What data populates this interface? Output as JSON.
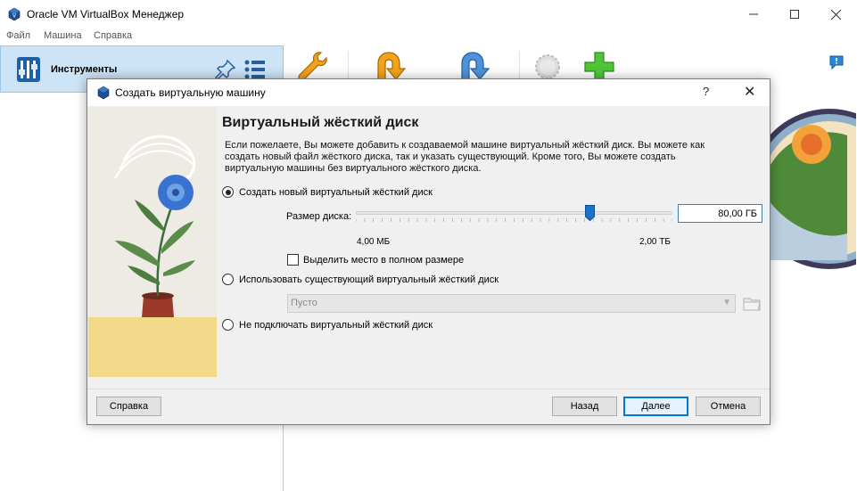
{
  "window": {
    "title": "Oracle VM VirtualBox Менеджер"
  },
  "menu": [
    "Файл",
    "Машина",
    "Справка"
  ],
  "toolbar": {
    "tools_label": "Инструменты"
  },
  "dialog": {
    "title": "Создать виртуальную машину",
    "help_glyph": "?",
    "close_glyph": "✕",
    "heading": "Виртуальный жёсткий диск",
    "description": "Если пожелаете, Вы можете добавить к создаваемой машине виртуальный жёсткий диск. Вы можете как создать новый файл жёсткого диска, так и указать существующий. Кроме того, Вы можете создать виртуальную машины без виртуального жёсткого диска.",
    "options": {
      "create_new": "Создать новый виртуальный жёсткий диск",
      "use_existing": "Использовать существующий виртуальный жёсткий диск",
      "no_disk": "Не подключать виртуальный жёсткий диск"
    },
    "selected_option": "create_new",
    "disk_size": {
      "label": "Размер диска:",
      "value": "80,00 ГБ",
      "min_label": "4,00 МБ",
      "max_label": "2,00 ТБ",
      "slider_fraction": 0.74
    },
    "preallocate": {
      "label": "Выделить место в полном размере",
      "checked": false
    },
    "existing_disk": {
      "value": "Пусто"
    },
    "buttons": {
      "help": "Справка",
      "back": "Назад",
      "next": "Далее",
      "cancel": "Отмена"
    }
  },
  "colors": {
    "selection": "#cde4f7",
    "accent": "#0078d7",
    "slider_thumb": "#1a73c9"
  }
}
